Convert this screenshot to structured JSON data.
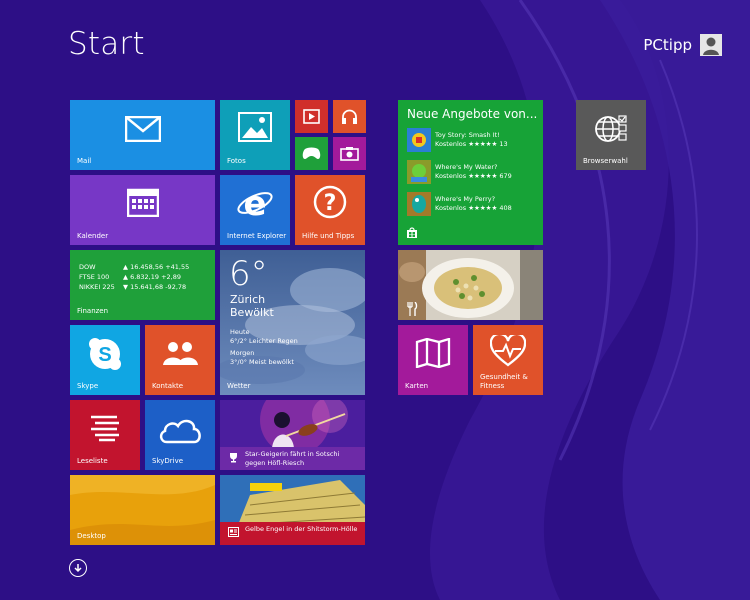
{
  "start": {
    "title": "Start"
  },
  "user": {
    "name": "PCtipp"
  },
  "tiles": {
    "mail": "Mail",
    "fotos": "Fotos",
    "kalender": "Kalender",
    "ie": "Internet Explorer",
    "hilfe": "Hilfe und Tipps",
    "finanzen": "Finanzen",
    "wetter": "Wetter",
    "skype": "Skype",
    "kontakte": "Kontakte",
    "leseliste": "Leseliste",
    "skydrive": "SkyDrive",
    "desktop": "Desktop",
    "karten": "Karten",
    "gesundheit": "Gesundheit & Fitness",
    "browserwahl": "Browserwahl"
  },
  "finance": {
    "rows": [
      {
        "name": "DOW",
        "value": "▲ 16.458,56 +41,55"
      },
      {
        "name": "FTSE 100",
        "value": "▲ 6.832,19 +2,89"
      },
      {
        "name": "NIKKEI 225",
        "value": "▼ 15.641,68 -92,78"
      }
    ]
  },
  "weather": {
    "temp": "6°",
    "city": "Zürich",
    "condition": "Bewölkt",
    "today_label": "Heute",
    "today_text": "6°/2° Leichter Regen",
    "tomorrow_label": "Morgen",
    "tomorrow_text": "3°/0° Meist bewölkt"
  },
  "store": {
    "title": "Neue Angebote von...",
    "items": [
      {
        "name": "Toy Story: Smash It!",
        "meta": "Kostenlos ★★★★★ 13"
      },
      {
        "name": "Where's My Water?",
        "meta": "Kostenlos ★★★★★ 679"
      },
      {
        "name": "Where's My Perry?",
        "meta": "Kostenlos ★★★★★ 408"
      }
    ]
  },
  "news": {
    "sport": "Star-Geigerin fährt in Sotschi gegen Höfl-Riesch",
    "news": "Gelbe Engel in der Shitstorm-Hölle"
  },
  "colors": {
    "background": "#2d0f86",
    "mail": "#1b8fe3",
    "fotos": "#0e9fb8",
    "red": "#d02f2b",
    "orange": "#e0522a",
    "green": "#1fa03a",
    "magenta": "#a31a9b",
    "purple": "#7737c6",
    "ie": "#2070d4",
    "skype": "#10a6e3",
    "leseliste": "#c2142e",
    "skydrive": "#1d5fc7",
    "desktop": "#e8a10b",
    "store": "#17a337",
    "browserwahl": "#595959"
  }
}
